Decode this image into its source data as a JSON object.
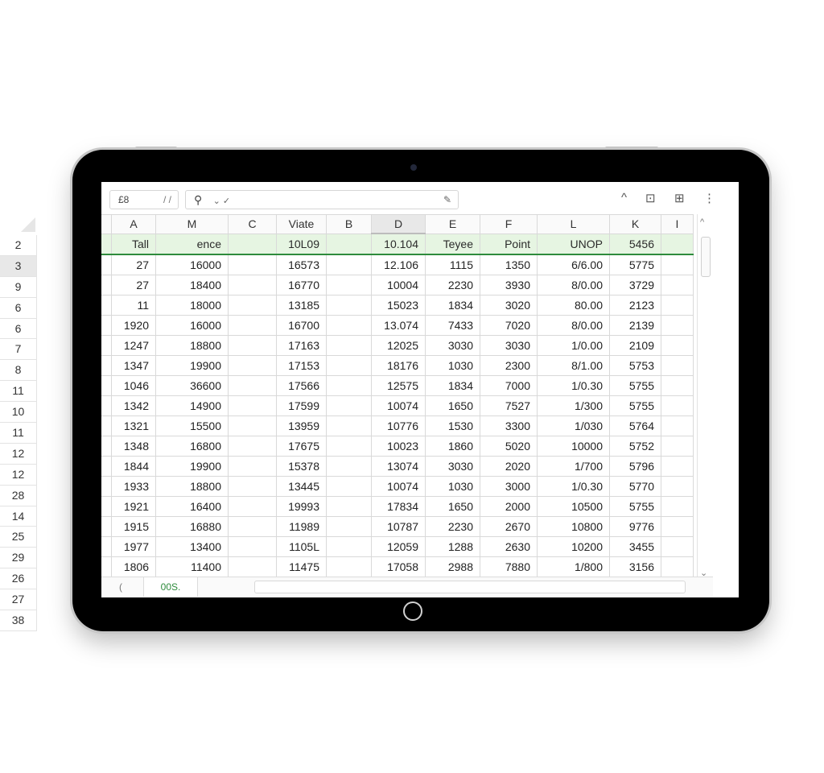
{
  "outside_row_numbers": [
    "2",
    "3",
    "9",
    "6",
    "6",
    "7",
    "8",
    "11",
    "10",
    "11",
    "12",
    "12",
    "28",
    "14",
    "25",
    "29",
    "26",
    "27",
    "38"
  ],
  "toolbar": {
    "namebox": "£8",
    "namebox_extra": "/ /",
    "formula_icon": "⚲",
    "formula_arrows": "⌄ ✓",
    "right_icons": [
      "^",
      "⊡",
      "⊞",
      "⋮"
    ]
  },
  "columns": [
    "A",
    "M",
    "C",
    "Viate",
    "B",
    "D",
    "E",
    "F",
    "L",
    "K",
    "I"
  ],
  "header_row": [
    "Tall",
    "ence",
    "",
    "10L09",
    "",
    "10.104",
    "Teyee",
    "Point",
    "UNOP",
    "5456",
    ""
  ],
  "rows": [
    [
      "27",
      "16000",
      "",
      "16573",
      "",
      "12.106",
      "1115",
      "1350",
      "6/6.00",
      "5775",
      ""
    ],
    [
      "27",
      "18400",
      "",
      "16770",
      "",
      "10004",
      "2230",
      "3930",
      "8/0.00",
      "3729",
      ""
    ],
    [
      "11",
      "18000",
      "",
      "13185",
      "",
      "15023",
      "1834",
      "3020",
      "80.00",
      "2123",
      ""
    ],
    [
      "1920",
      "16000",
      "",
      "16700",
      "",
      "13.074",
      "7433",
      "7020",
      "8/0.00",
      "2139",
      ""
    ],
    [
      "1247",
      "18800",
      "",
      "17163",
      "",
      "12025",
      "3030",
      "3030",
      "1/0.00",
      "2109",
      ""
    ],
    [
      "1347",
      "19900",
      "",
      "17153",
      "",
      "18176",
      "1030",
      "2300",
      "8/1.00",
      "5753",
      ""
    ],
    [
      "1046",
      "36600",
      "",
      "17566",
      "",
      "12575",
      "1834",
      "7000",
      "1/0.30",
      "5755",
      ""
    ],
    [
      "1342",
      "14900",
      "",
      "17599",
      "",
      "10074",
      "1650",
      "7527",
      "1/300",
      "5755",
      ""
    ],
    [
      "1321",
      "15500",
      "",
      "13959",
      "",
      "10776",
      "1530",
      "3300",
      "1/030",
      "5764",
      ""
    ],
    [
      "1348",
      "16800",
      "",
      "17675",
      "",
      "10023",
      "1860",
      "5020",
      "10000",
      "5752",
      ""
    ],
    [
      "1844",
      "19900",
      "",
      "15378",
      "",
      "13074",
      "3030",
      "2020",
      "1/700",
      "5796",
      ""
    ],
    [
      "1933",
      "18800",
      "",
      "13445",
      "",
      "10074",
      "1030",
      "3000",
      "1/0.30",
      "5770",
      ""
    ],
    [
      "1921",
      "16400",
      "",
      "19993",
      "",
      "17834",
      "1650",
      "2000",
      "10500",
      "5755",
      ""
    ],
    [
      "1915",
      "16880",
      "",
      "11989",
      "",
      "10787",
      "2230",
      "2670",
      "10800",
      "9776",
      ""
    ],
    [
      "1977",
      "13400",
      "",
      "1105L",
      "",
      "12059",
      "1288",
      "2630",
      "10200",
      "3455",
      ""
    ],
    [
      "1806",
      "11400",
      "",
      "11475",
      "",
      "17058",
      "2988",
      "7880",
      "1/800",
      "3156",
      ""
    ]
  ],
  "bottom": {
    "nav_left": "(",
    "sheet_tab": "00S.",
    "h_icon": "&"
  }
}
